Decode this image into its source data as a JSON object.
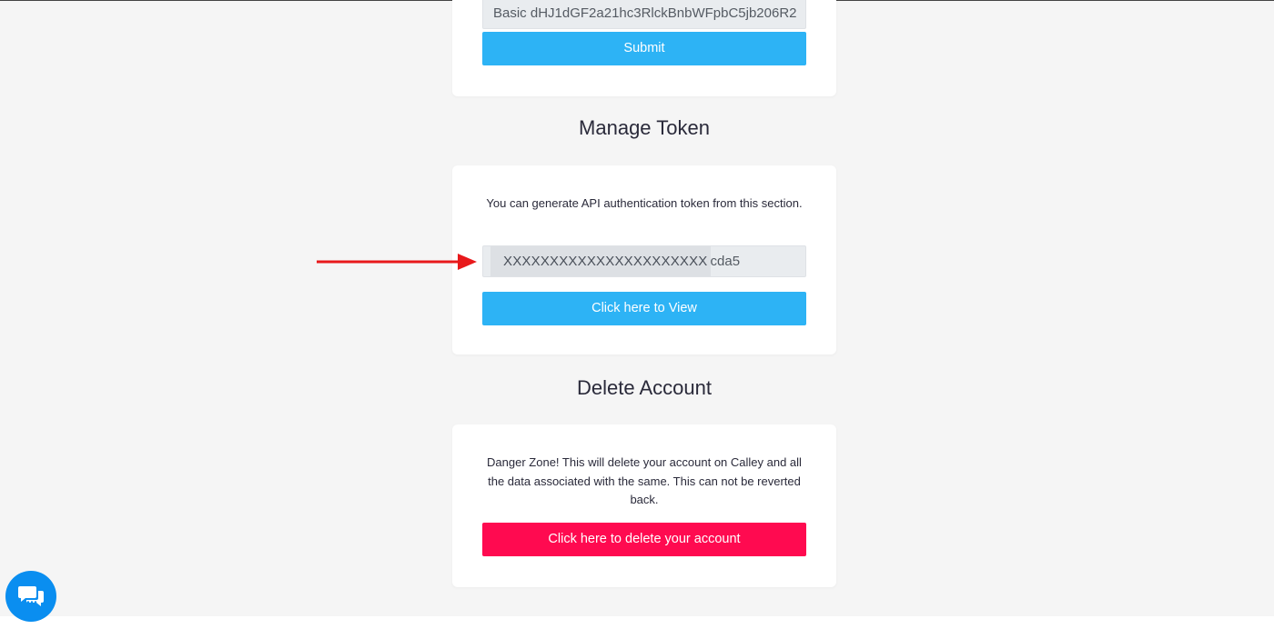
{
  "auth_card": {
    "auth_value": "Basic dHJ1dGF2a21hc3RlckBnbWFpbC5jb206R2",
    "submit_label": "Submit"
  },
  "manage_token": {
    "title": "Manage Token",
    "description": "You can generate API authentication token from this section.",
    "token_masked": "XXXXXXXXXXXXXXXXXXXXXX",
    "token_suffix": "cda5",
    "view_button_label": "Click here to View"
  },
  "delete_account": {
    "title": "Delete Account",
    "warning": "Danger Zone! This will delete your account on Calley and all the data associated with the same. This can not be reverted back.",
    "delete_button_label": "Click here to delete your account"
  },
  "chat_widget": {
    "icon": "chat-icon"
  },
  "colors": {
    "primary_button": "#2db3f5",
    "danger_button": "#ff0a50",
    "annotation_arrow": "#e8191b",
    "chat_bubble": "#0a8ef0"
  }
}
